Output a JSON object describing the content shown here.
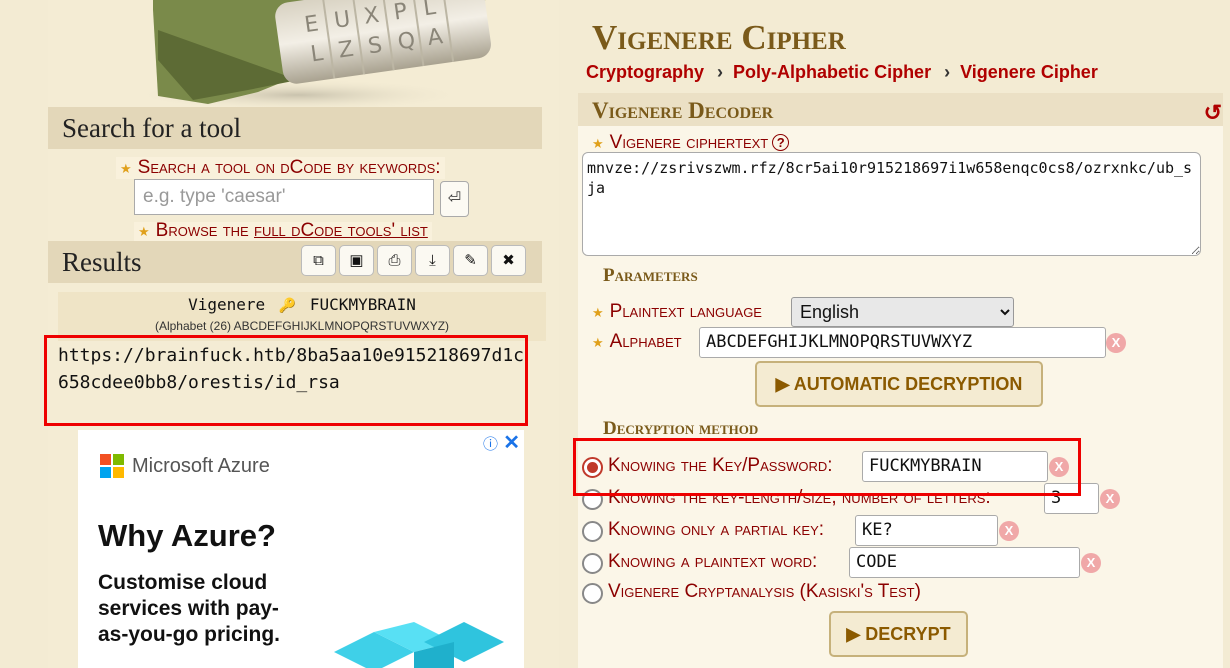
{
  "sidebar": {
    "search": {
      "header": "Search for a tool",
      "keywords_label": "Search a tool on dCode by keywords:",
      "placeholder": "e.g. type 'caesar'",
      "enter_glyph": "⏎",
      "browse_prefix": "Browse the ",
      "browse_link": "full dCode tools' list"
    },
    "results": {
      "header": "Results",
      "tools": [
        {
          "name": "copy-icon",
          "glyph": "⧉"
        },
        {
          "name": "screenshot-icon",
          "glyph": "▣"
        },
        {
          "name": "print-icon",
          "glyph": "⎙"
        },
        {
          "name": "download-icon",
          "glyph": "⤓"
        },
        {
          "name": "pin-icon",
          "glyph": "✎"
        },
        {
          "name": "close-icon",
          "glyph": "✖"
        }
      ],
      "cipher_name": "Vigenere",
      "key_glyph": "🔑",
      "key_value": "FUCKMYBRAIN",
      "alphabet_note": "(Alphabet (26) ABCDEFGHIJKLMNOPQRSTUVWXYZ)",
      "plaintext": "https://brainfuck.htb/8ba5aa10e915218697d1c658cdee0bb8/orestis/id_rsa"
    },
    "ad": {
      "info_glyph": "ⓘ",
      "close_glyph": "✕",
      "brand": "Microsoft Azure",
      "title": "Why Azure?",
      "body": "Customise cloud services with pay-as-you-go pricing."
    }
  },
  "page": {
    "title": "Vigenere Cipher",
    "breadcrumb": [
      "Cryptography",
      "Poly-Alphabetic Cipher",
      "Vigenere Cipher"
    ]
  },
  "decoder": {
    "header": "Vigenere Decoder",
    "ciphertext_label": "Vigenere ciphertext",
    "ciphertext": "mnvze://zsrivszwm.rfz/8cr5ai10r915218697i1w658enqc0cs8/ozrxnkc/ub_sja",
    "parameters_title": "Parameters",
    "language_label": "Plaintext language",
    "language_value": "English",
    "alphabet_label": "Alphabet",
    "alphabet_value": "ABCDEFGHIJKLMNOPQRSTUVWXYZ",
    "auto_button": "▶ AUTOMATIC DECRYPTION",
    "method_title": "Decryption method",
    "methods": [
      {
        "label": "Knowing the Key/Password:",
        "value": "FUCKMYBRAIN",
        "checked": true
      },
      {
        "label": "Knowing the key-length/size, number of letters:",
        "value": "3",
        "checked": false
      },
      {
        "label": "Knowing only a partial key:",
        "value": "KE?",
        "checked": false
      },
      {
        "label": "Knowing a plaintext word:",
        "value": "CODE",
        "checked": false
      },
      {
        "label": "Vigenere Cryptanalysis (Kasiski's Test)",
        "checked": false
      }
    ],
    "decrypt_button": "▶ DECRYPT",
    "clear_glyph": "X"
  },
  "colors": {
    "background": "#f3ebd3",
    "link_red": "#b00000",
    "title_brown": "#7a5a1a",
    "highlight": "#ee0000"
  }
}
